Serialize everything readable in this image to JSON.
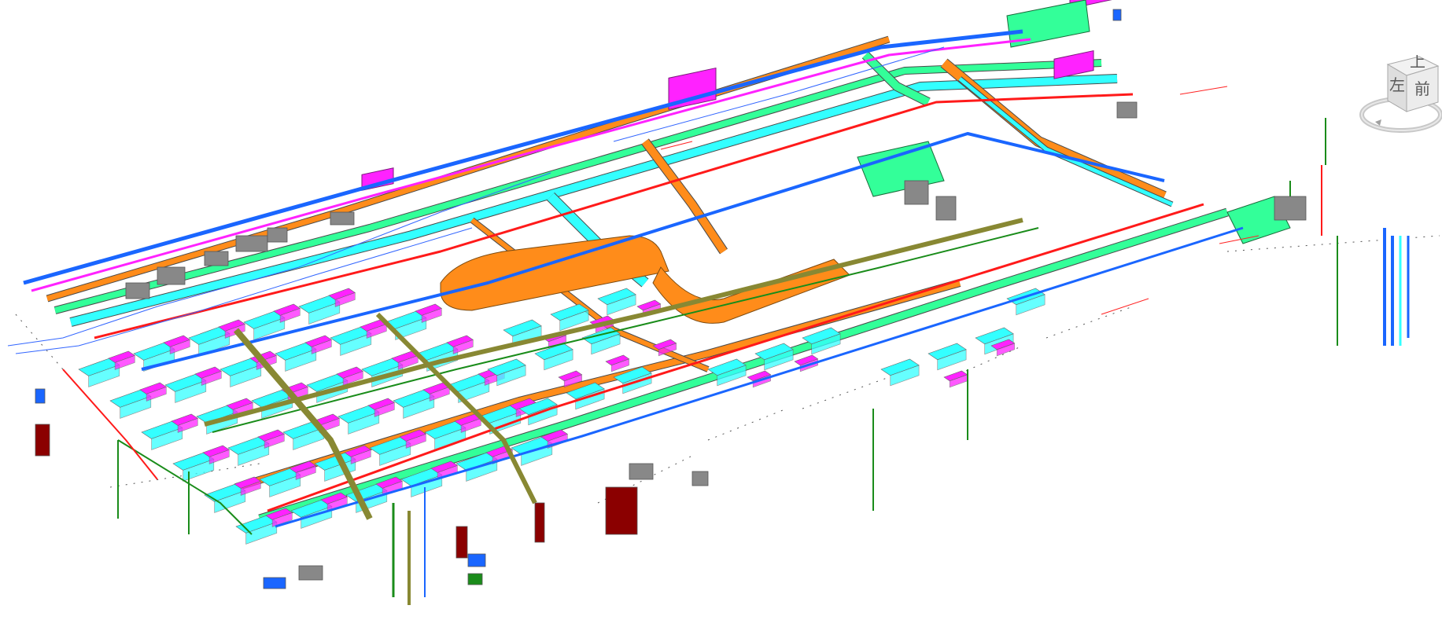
{
  "view": {
    "type": "3D isometric MEP coordination view",
    "colors": {
      "chilled_water": "#ff8c1a",
      "supply_air": "#33ffff",
      "return_air": "#ff22ff",
      "exhaust_air": "#33ff99",
      "fire_pipe": "#ff1a1a",
      "domestic_water": "#1a66ff",
      "cable_tray": "#888833",
      "drain": "#1a8c1a",
      "equipment": "#888888",
      "fire_hydrant_box": "#8b0000"
    }
  },
  "viewcube": {
    "top_label": "上",
    "left_label": "左",
    "front_label": "前",
    "cube_icon": "view-cube-icon",
    "compass_icon": "compass-ring-icon"
  }
}
